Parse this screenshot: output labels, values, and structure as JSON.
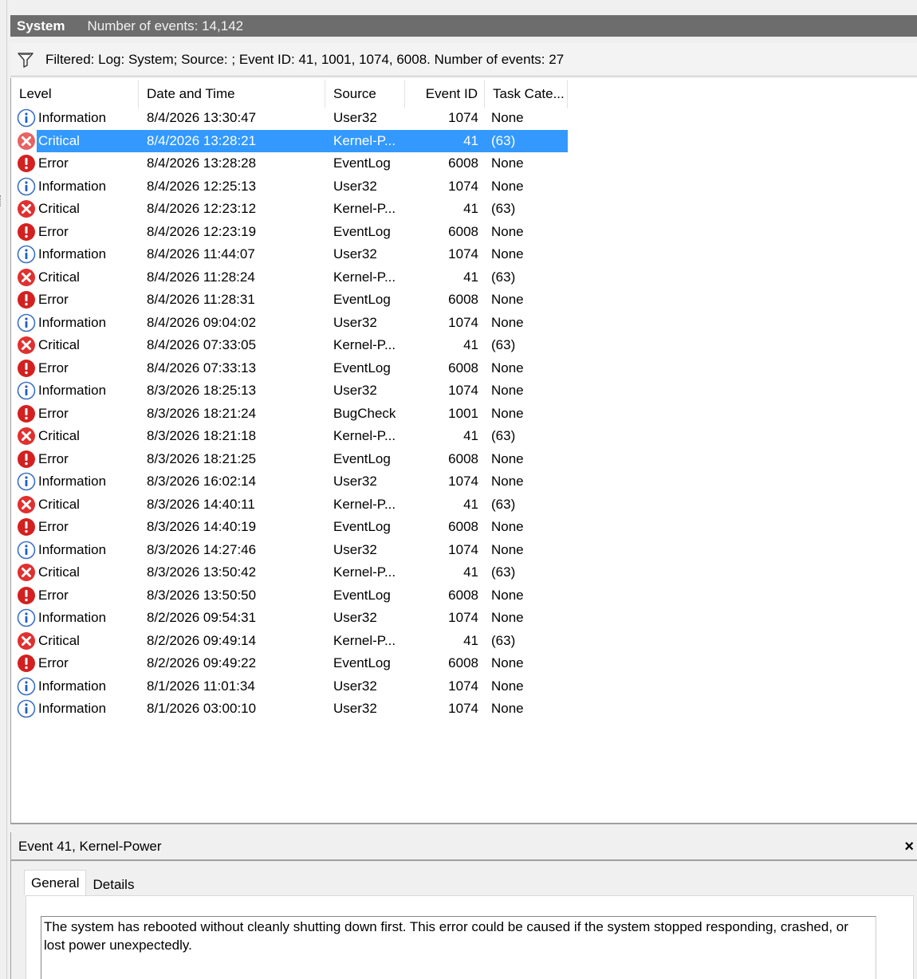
{
  "header": {
    "log_name": "System",
    "event_count": "Number of events: 14,142"
  },
  "filter": {
    "icon": "filter-funnel-icon",
    "text": "Filtered: Log: System; Source: ; Event ID: 41, 1001, 1074, 6008. Number of events: 27"
  },
  "columns": [
    "Level",
    "Date and Time",
    "Source",
    "Event ID",
    "Task Cate..."
  ],
  "events": [
    {
      "level": "Information",
      "icon": "info-icon",
      "date": "8/4/2026 13:30:47",
      "source": "User32",
      "id": "1074",
      "task": "None",
      "selected": false
    },
    {
      "level": "Critical",
      "icon": "critical-icon",
      "date": "8/4/2026 13:28:21",
      "source": "Kernel-P...",
      "id": "41",
      "task": "(63)",
      "selected": true
    },
    {
      "level": "Error",
      "icon": "error-icon",
      "date": "8/4/2026 13:28:28",
      "source": "EventLog",
      "id": "6008",
      "task": "None",
      "selected": false
    },
    {
      "level": "Information",
      "icon": "info-icon",
      "date": "8/4/2026 12:25:13",
      "source": "User32",
      "id": "1074",
      "task": "None",
      "selected": false
    },
    {
      "level": "Critical",
      "icon": "critical-icon",
      "date": "8/4/2026 12:23:12",
      "source": "Kernel-P...",
      "id": "41",
      "task": "(63)",
      "selected": false
    },
    {
      "level": "Error",
      "icon": "error-icon",
      "date": "8/4/2026 12:23:19",
      "source": "EventLog",
      "id": "6008",
      "task": "None",
      "selected": false
    },
    {
      "level": "Information",
      "icon": "info-icon",
      "date": "8/4/2026 11:44:07",
      "source": "User32",
      "id": "1074",
      "task": "None",
      "selected": false
    },
    {
      "level": "Critical",
      "icon": "critical-icon",
      "date": "8/4/2026 11:28:24",
      "source": "Kernel-P...",
      "id": "41",
      "task": "(63)",
      "selected": false
    },
    {
      "level": "Error",
      "icon": "error-icon",
      "date": "8/4/2026 11:28:31",
      "source": "EventLog",
      "id": "6008",
      "task": "None",
      "selected": false
    },
    {
      "level": "Information",
      "icon": "info-icon",
      "date": "8/4/2026 09:04:02",
      "source": "User32",
      "id": "1074",
      "task": "None",
      "selected": false
    },
    {
      "level": "Critical",
      "icon": "critical-icon",
      "date": "8/4/2026 07:33:05",
      "source": "Kernel-P...",
      "id": "41",
      "task": "(63)",
      "selected": false
    },
    {
      "level": "Error",
      "icon": "error-icon",
      "date": "8/4/2026 07:33:13",
      "source": "EventLog",
      "id": "6008",
      "task": "None",
      "selected": false
    },
    {
      "level": "Information",
      "icon": "info-icon",
      "date": "8/3/2026 18:25:13",
      "source": "User32",
      "id": "1074",
      "task": "None",
      "selected": false
    },
    {
      "level": "Error",
      "icon": "error-icon",
      "date": "8/3/2026 18:21:24",
      "source": "BugCheck",
      "id": "1001",
      "task": "None",
      "selected": false
    },
    {
      "level": "Critical",
      "icon": "critical-icon",
      "date": "8/3/2026 18:21:18",
      "source": "Kernel-P...",
      "id": "41",
      "task": "(63)",
      "selected": false
    },
    {
      "level": "Error",
      "icon": "error-icon",
      "date": "8/3/2026 18:21:25",
      "source": "EventLog",
      "id": "6008",
      "task": "None",
      "selected": false
    },
    {
      "level": "Information",
      "icon": "info-icon",
      "date": "8/3/2026 16:02:14",
      "source": "User32",
      "id": "1074",
      "task": "None",
      "selected": false
    },
    {
      "level": "Critical",
      "icon": "critical-icon",
      "date": "8/3/2026 14:40:11",
      "source": "Kernel-P...",
      "id": "41",
      "task": "(63)",
      "selected": false
    },
    {
      "level": "Error",
      "icon": "error-icon",
      "date": "8/3/2026 14:40:19",
      "source": "EventLog",
      "id": "6008",
      "task": "None",
      "selected": false
    },
    {
      "level": "Information",
      "icon": "info-icon",
      "date": "8/3/2026 14:27:46",
      "source": "User32",
      "id": "1074",
      "task": "None",
      "selected": false
    },
    {
      "level": "Critical",
      "icon": "critical-icon",
      "date": "8/3/2026 13:50:42",
      "source": "Kernel-P...",
      "id": "41",
      "task": "(63)",
      "selected": false
    },
    {
      "level": "Error",
      "icon": "error-icon",
      "date": "8/3/2026 13:50:50",
      "source": "EventLog",
      "id": "6008",
      "task": "None",
      "selected": false
    },
    {
      "level": "Information",
      "icon": "info-icon",
      "date": "8/2/2026 09:54:31",
      "source": "User32",
      "id": "1074",
      "task": "None",
      "selected": false
    },
    {
      "level": "Critical",
      "icon": "critical-icon",
      "date": "8/2/2026 09:49:14",
      "source": "Kernel-P...",
      "id": "41",
      "task": "(63)",
      "selected": false
    },
    {
      "level": "Error",
      "icon": "error-icon",
      "date": "8/2/2026 09:49:22",
      "source": "EventLog",
      "id": "6008",
      "task": "None",
      "selected": false
    },
    {
      "level": "Information",
      "icon": "info-icon",
      "date": "8/1/2026 11:01:34",
      "source": "User32",
      "id": "1074",
      "task": "None",
      "selected": false
    },
    {
      "level": "Information",
      "icon": "info-icon",
      "date": "8/1/2026 03:00:10",
      "source": "User32",
      "id": "1074",
      "task": "None",
      "selected": false
    }
  ],
  "details": {
    "title": "Event 41, Kernel-Power",
    "close_label": "×",
    "tabs": [
      {
        "label": "General",
        "active": true
      },
      {
        "label": "Details",
        "active": false
      }
    ],
    "message": "The system has rebooted without cleanly shutting down first. This error could be caused if the system stopped responding, crashed, or lost power unexpectedly."
  },
  "colors": {
    "selection": "#3399ff",
    "title_bar": "#6d6d6d",
    "info": "#1f5fbf",
    "error": "#d32020",
    "critical": "#e03030"
  }
}
